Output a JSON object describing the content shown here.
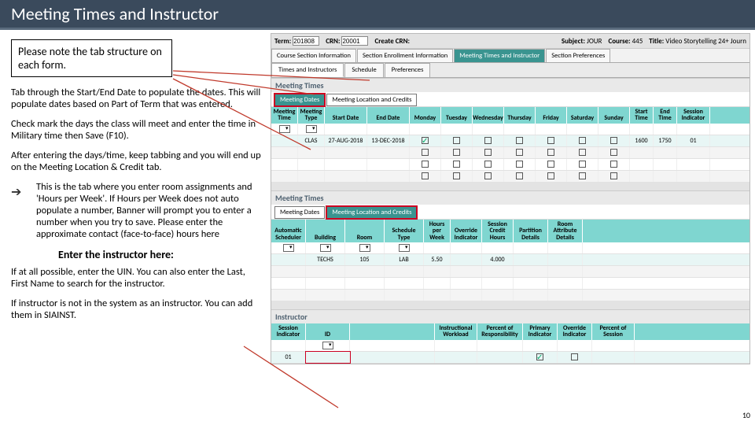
{
  "slide": {
    "title": "Meeting Times and Instructor",
    "page_number": "10"
  },
  "notes": {
    "tab_note": "Please note the tab structure on each form.",
    "p1": "Tab through the Start/End Date to populate the dates. This will populate dates based on Part of Term that was entered.",
    "p2": "Check mark the days the class will meet and enter the time in Military time then Save (F10).",
    "p3": "After entering the days/time, keep tabbing and you will end up on the Meeting Location & Credit tab.",
    "bullet": "This is the tab where you enter room assignments and 'Hours per Week'. If Hours per Week does not auto populate a number, Banner will prompt you to enter a number when you try to save. Please enter the approximate contact (face-to-face) hours here",
    "enter_instr": "Enter the instructor here:",
    "p4": "If at all possible, enter the UIN. You can also enter the Last, First Name to search for the instructor.",
    "p5": "If instructor is not in the system as an instructor. You can add them in SIAINST."
  },
  "header": {
    "term_lbl": "Term:",
    "term_val": "201808",
    "crn_lbl": "CRN:",
    "crn_val": "20001",
    "create_lbl": "Create CRN:",
    "subject_lbl": "Subject:",
    "subject_val": "JOUR",
    "course_lbl": "Course:",
    "course_val": "445",
    "title_lbl": "Title:",
    "title_val": "Video Storytelling 24+ Journ"
  },
  "tabs1": {
    "a": "Course Section Information",
    "b": "Section Enrollment Information",
    "c": "Meeting Times and Instructor",
    "d": "Section Preferences"
  },
  "tabs2": {
    "a": "Times and Instructors",
    "b": "Schedule",
    "c": "Preferences"
  },
  "section1": {
    "title": "Meeting Times",
    "inner_a": "Meeting Dates",
    "inner_b": "Meeting Location and Credits",
    "cols": {
      "meeting_time": "Meeting Time",
      "meeting_type": "Meeting Type",
      "start": "Start Date",
      "end": "End Date",
      "mon": "Monday",
      "tue": "Tuesday",
      "wed": "Wednesday",
      "thu": "Thursday",
      "fri": "Friday",
      "sat": "Saturday",
      "sun": "Sunday",
      "stime": "Start Time",
      "etime": "End Time",
      "sind": "Session Indicator"
    },
    "row": {
      "type": "CLAS",
      "start": "27-AUG-2018",
      "end": "13-DEC-2018",
      "stime": "1600",
      "etime": "1750",
      "sind": "01"
    }
  },
  "section2": {
    "title": "Meeting Times",
    "inner_a": "Meeting Dates",
    "inner_b": "Meeting Location and Credits",
    "cols": {
      "auto": "Automatic Scheduler",
      "bld": "Building",
      "room": "Room",
      "st": "Schedule Type",
      "hpw": "Hours per Week",
      "ov": "Override Indicator",
      "sch": "Session Credit Hours",
      "pd": "Partition Details",
      "rad": "Room Attribute Details"
    },
    "row": {
      "bld": "TECHS",
      "room": "105",
      "st": "LAB",
      "hpw": "5.50",
      "sch": "4.000"
    }
  },
  "section3": {
    "title": "Instructor",
    "cols": {
      "ses": "Session Indicator",
      "id": "ID",
      "name": "",
      "iw": "Instructional Workload",
      "por": "Percent of Responsibility",
      "pi": "Primary Indicator",
      "oi": "Override Indicator",
      "ps": "Percent of Session"
    },
    "row": {
      "ses": "01",
      "name": "",
      "iw": "",
      "por": "",
      "ps": ""
    }
  }
}
